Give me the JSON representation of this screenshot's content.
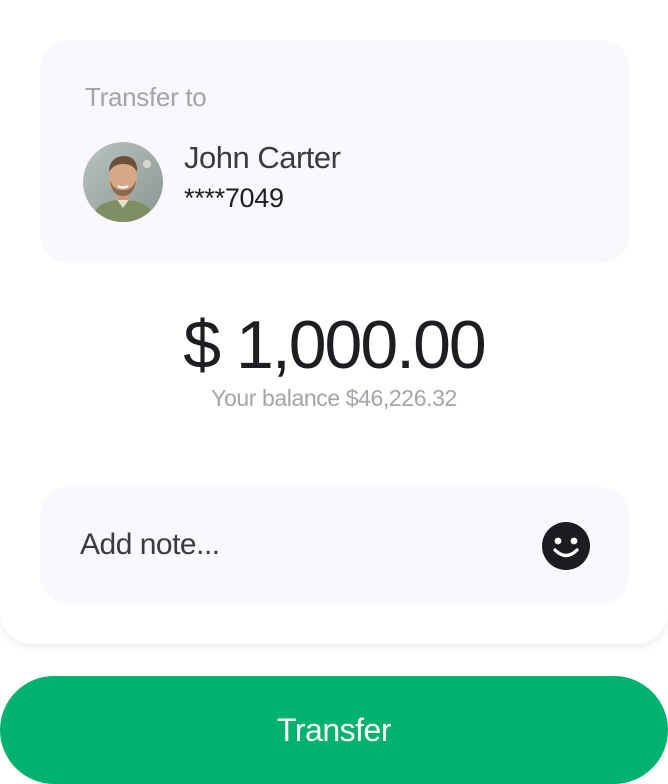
{
  "recipient": {
    "heading": "Transfer to",
    "name": "John Carter",
    "account": "****7049"
  },
  "amount": {
    "value": "$ 1,000.00",
    "balance_text": "Your balance $46,226.32"
  },
  "note": {
    "placeholder": "Add note...",
    "value": ""
  },
  "actions": {
    "transfer_label": "Transfer",
    "emoji_icon": "smiley-face-icon"
  },
  "colors": {
    "accent": "#00b26f",
    "card_bg": "#f9f8fc"
  }
}
